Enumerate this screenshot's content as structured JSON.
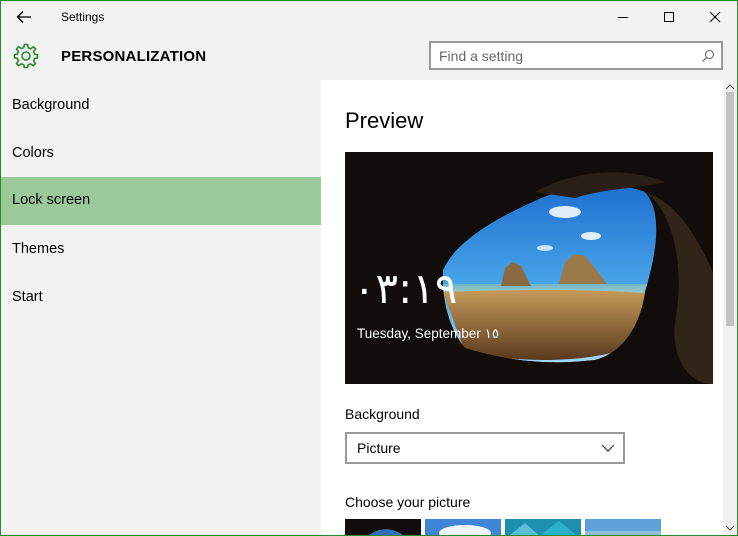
{
  "window": {
    "title": "Settings",
    "accent_color": "#2a8a2a",
    "controls": [
      "minimize-icon",
      "maximize-icon",
      "close-icon"
    ]
  },
  "header": {
    "icon": "gear-icon",
    "title": "PERSONALIZATION",
    "search_placeholder": "Find a setting",
    "search_value": ""
  },
  "sidebar": {
    "items": [
      {
        "label": "Background",
        "active": false
      },
      {
        "label": "Colors",
        "active": false
      },
      {
        "label": "Lock screen",
        "active": true
      },
      {
        "label": "Themes",
        "active": false
      },
      {
        "label": "Start",
        "active": false
      }
    ],
    "active_color": "#9cc99a"
  },
  "main": {
    "preview_title": "Preview",
    "lock_preview": {
      "time": "٠٣:١٩",
      "date": "Tuesday, September ١٥"
    },
    "background_label": "Background",
    "background_value": "Picture",
    "choose_label": "Choose your picture"
  }
}
